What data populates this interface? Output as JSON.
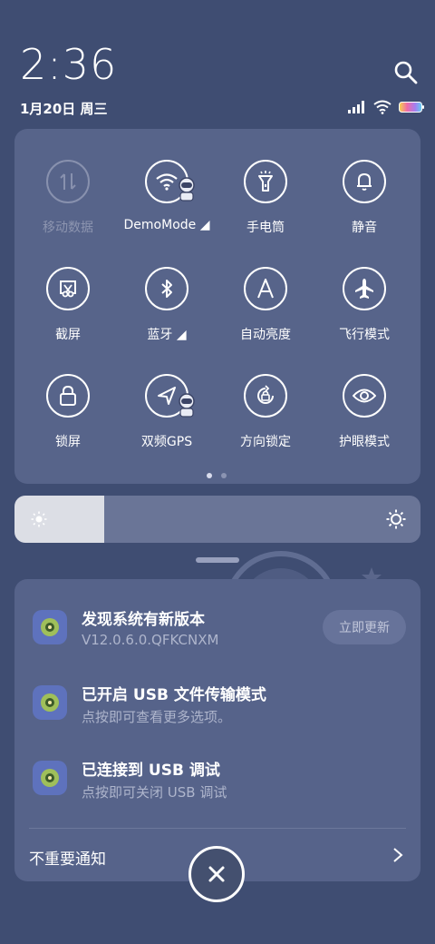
{
  "header": {
    "time": "2:36",
    "date": "1月20日 周三"
  },
  "status_icons": [
    "signal-icon",
    "wifi-icon",
    "battery-icon"
  ],
  "toggles": [
    {
      "label": "移动数据",
      "icon": "mobile-data-icon",
      "active": false
    },
    {
      "label": "DemoMode ◢",
      "icon": "wifi-icon",
      "active": true
    },
    {
      "label": "手电筒",
      "icon": "flashlight-icon",
      "active": true
    },
    {
      "label": "静音",
      "icon": "bell-icon",
      "active": true
    },
    {
      "label": "截屏",
      "icon": "screenshot-icon",
      "active": true
    },
    {
      "label": "蓝牙 ◢",
      "icon": "bluetooth-icon",
      "active": true
    },
    {
      "label": "自动亮度",
      "icon": "auto-brightness-icon",
      "active": true
    },
    {
      "label": "飞行模式",
      "icon": "airplane-icon",
      "active": true
    },
    {
      "label": "锁屏",
      "icon": "lock-icon",
      "active": true
    },
    {
      "label": "双频GPS",
      "icon": "gps-icon",
      "active": true
    },
    {
      "label": "方向锁定",
      "icon": "rotation-lock-icon",
      "active": true
    },
    {
      "label": "护眼模式",
      "icon": "eye-icon",
      "active": true
    }
  ],
  "pager": {
    "pages": 2,
    "current": 1
  },
  "brightness": {
    "level": 0.22
  },
  "notifications": [
    {
      "title": "发现系统有新版本",
      "subtitle": "V12.0.6.0.QFKCNXM",
      "action": "立即更新"
    },
    {
      "title": "已开启 USB 文件传输模式",
      "subtitle": "点按即可查看更多选项。"
    },
    {
      "title": "已连接到 USB 调试",
      "subtitle": "点按即可关闭 USB 调试"
    }
  ],
  "unimportant_label": "不重要通知",
  "colors": {
    "background": "#3f4d72",
    "panel": "#57648a",
    "accent_icon": "#5e72bd"
  }
}
